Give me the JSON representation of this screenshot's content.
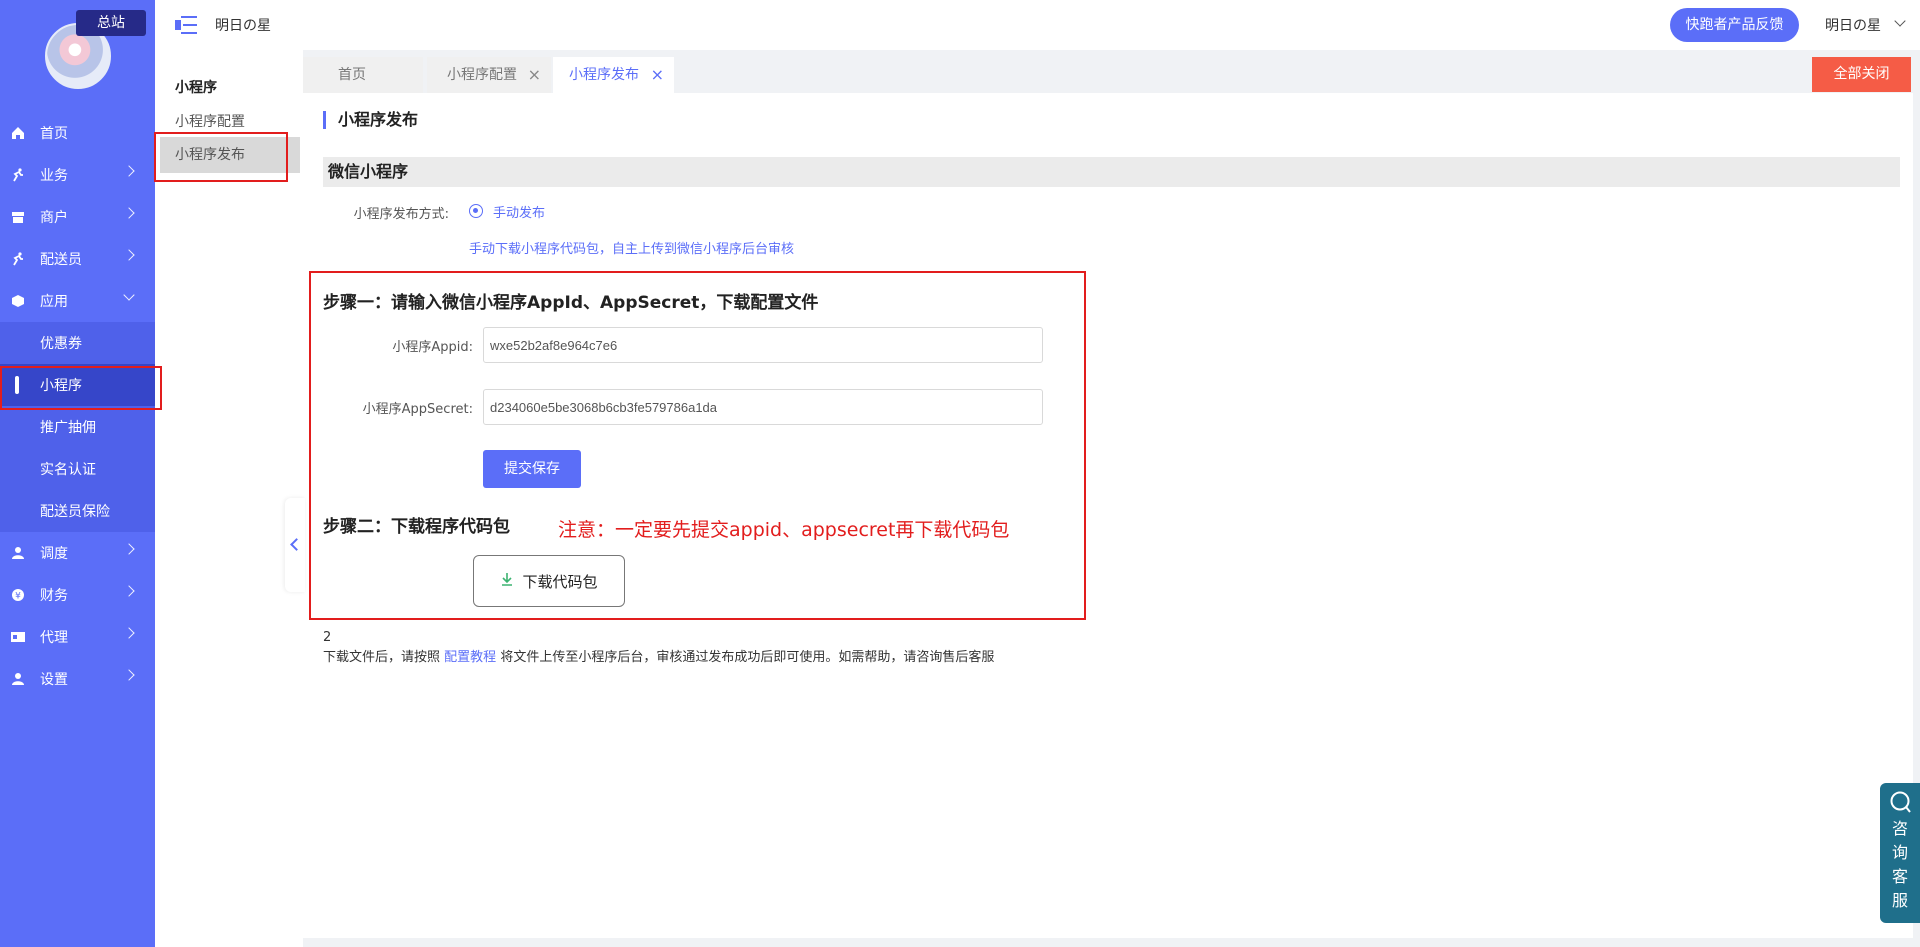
{
  "sidebar": {
    "tag": "总站",
    "items": [
      {
        "label": "首页",
        "icon": "home-icon"
      },
      {
        "label": "业务",
        "icon": "run-icon"
      },
      {
        "label": "商户",
        "icon": "shop-icon"
      },
      {
        "label": "配送员",
        "icon": "run-icon"
      },
      {
        "label": "应用",
        "icon": "cube-icon"
      }
    ],
    "sub_items": [
      {
        "label": "优惠券"
      },
      {
        "label": "小程序"
      },
      {
        "label": "推广抽佣"
      },
      {
        "label": "实名认证"
      },
      {
        "label": "配送员保险"
      }
    ],
    "items_after": [
      {
        "label": "调度",
        "icon": "user-icon"
      },
      {
        "label": "财务",
        "icon": "coin-icon"
      },
      {
        "label": "代理",
        "icon": "card-icon"
      },
      {
        "label": "设置",
        "icon": "user-icon"
      }
    ]
  },
  "menu2": {
    "title": "小程序",
    "items": [
      "小程序配置",
      "小程序发布"
    ]
  },
  "header": {
    "brand": "明日の星",
    "feedback": "快跑者产品反馈",
    "user": "明日の星"
  },
  "tabs": [
    {
      "label": "首页"
    },
    {
      "label": "小程序配置"
    },
    {
      "label": "小程序发布"
    }
  ],
  "close_all": "全部关闭",
  "main": {
    "title": "小程序发布",
    "section": "微信小程序",
    "method_label": "小程序发布方式:",
    "method_option": "手动发布",
    "hint": "手动下载小程序代码包，自主上传到微信小程序后台审核",
    "step1": "步骤一：请输入微信小程序AppId、AppSecret，下载配置文件",
    "appid_label": "小程序Appid:",
    "appid_value": "wxe52b2af8e964c7e6",
    "secret_label": "小程序AppSecret:",
    "secret_value": "d234060e5be3068b6cb3fe579786a1da",
    "submit": "提交保存",
    "step2": "步骤二：下载程序代码包",
    "notice": "注意：一定要先提交appid、appsecret再下载代码包",
    "download": "下载代码包",
    "foot_num": "2",
    "foot_pre": "下载文件后，请按照",
    "foot_link": "配置教程",
    "foot_post": "将文件上传至小程序后台，审核通过发布成功后即可使用。如需帮助，请咨询售后客服"
  },
  "service": {
    "chars": [
      "咨",
      "询",
      "客",
      "服"
    ]
  },
  "colors": {
    "accent": "#5b6ef8",
    "danger": "#e21d1d",
    "close_all": "#f55c46"
  }
}
